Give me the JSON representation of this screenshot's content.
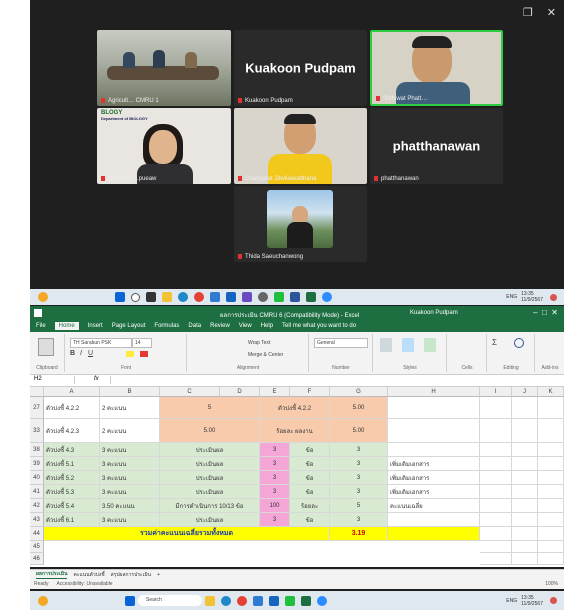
{
  "zoom": {
    "controls": [
      "❐",
      "✕"
    ],
    "participants": [
      {
        "name": "Agricult… CMRU 1",
        "kind": "video-room"
      },
      {
        "name": "Kuakoon Pudpam",
        "kind": "name-only"
      },
      {
        "name": "Sitthiwat Phatt…",
        "kind": "video-man"
      },
      {
        "name": "Natthinee ..pueaw",
        "kind": "video-woman-glasses"
      },
      {
        "name": "Chanyarat Jitwilaiwatthana",
        "kind": "video-man-yellow"
      },
      {
        "name": "phatthanawan",
        "kind": "name-only"
      },
      {
        "name": "Thida Saeuchanwong",
        "kind": "photo-woman"
      }
    ],
    "big_names": {
      "kuakoon": "Kuakoon Pudpam",
      "phatthanawan": "phatthanawan"
    },
    "logo_text": "BLOGY",
    "logo_sub": "Department of BIOLOGY"
  },
  "taskbar_top": {
    "time": "13:35",
    "date": "11/9/2567",
    "tray": "ENG"
  },
  "excel": {
    "title": "ผลการประเมิน CMRU 6 (Compatibility Mode) - Excel",
    "user": "Kuakoon Pudpam",
    "tabs": [
      "File",
      "Home",
      "Insert",
      "Page Layout",
      "Formulas",
      "Data",
      "Review",
      "View",
      "Help",
      "Tell me what you want to do"
    ],
    "active_tab": "Home",
    "ribbon_groups": [
      "Clipboard",
      "Font",
      "Alignment",
      "Number",
      "Styles",
      "Cells",
      "Editing",
      "Add-ins"
    ],
    "font_name": "TH Sarabun PSK",
    "font_size": "14",
    "number_format": "General",
    "wrap_text": "Wrap Text",
    "merge": "Merge & Center",
    "cell_ref": "H2",
    "fx": "fx",
    "columns": [
      "A",
      "B",
      "C",
      "D",
      "E",
      "F",
      "G",
      "H",
      "I",
      "J",
      "K"
    ],
    "rows": [
      {
        "n": "27",
        "A": "ตัวบ่งชี้ 4.2.2",
        "B": "2 คะแนน",
        "C": "5",
        "EF": "ตัวบ่งชี้ 4.2.2",
        "G": "5.00"
      },
      {
        "n": "33",
        "A": "ตัวบ่งชี้ 4.2.3",
        "B": "2 คะแนน",
        "C": "5.00",
        "C2": "5",
        "EF": "ร้อยละ ผลงาน",
        "G": "5.00"
      },
      {
        "n": "38",
        "A": "ตัวบ่งชี้ 4.3",
        "B": "3 คะแนน",
        "C": "ประเมินผล",
        "E": "3",
        "F": "ข้อ",
        "G": "3",
        "H": ""
      },
      {
        "n": "39",
        "A": "ตัวบ่งชี้ 5.1",
        "B": "3 คะแนน",
        "C": "ประเมินผล",
        "E": "3",
        "F": "ข้อ",
        "G": "3",
        "H": "เพิ่มเติมเอกสาร"
      },
      {
        "n": "40",
        "A": "ตัวบ่งชี้ 5.2",
        "B": "3 คะแนน",
        "C": "ประเมินผล",
        "E": "3",
        "F": "ข้อ",
        "G": "3",
        "H": "เพิ่มเติมเอกสาร"
      },
      {
        "n": "41",
        "A": "ตัวบ่งชี้ 5.3",
        "B": "3 คะแนน",
        "C": "ประเมินผล",
        "E": "3",
        "F": "ข้อ",
        "G": "3",
        "H": "เพิ่มเติมเอกสาร"
      },
      {
        "n": "42",
        "A": "ตัวบ่งชี้ 5.4",
        "B": "3.50 คะแนน",
        "C": "มีการดำเนินการ 10/13 ข้อ",
        "E": "100",
        "F": "ร้อยละ",
        "G": "5",
        "H": "คะแนนเฉลี่ย"
      },
      {
        "n": "43",
        "A": "ตัวบ่งชี้ 6.1",
        "B": "3 คะแนน",
        "C": "ประเมินผล",
        "E": "3",
        "F": "ข้อ",
        "G": "3",
        "H": ""
      },
      {
        "n": "44",
        "total_label": "รวมค่าคะแนนเฉลี่ยรวมทั้งหมด",
        "G": "3.19"
      },
      {
        "n": "45"
      },
      {
        "n": "46"
      }
    ],
    "sheet_tabs": [
      "ผลการประเมิน",
      "คะแนนตัวบ่งชี้",
      "สรุปผลการประเมิน",
      "+"
    ],
    "status": "Ready",
    "status2": "Accessibility: Unavailable",
    "zoom_level": "100%"
  },
  "taskbar_bottom": {
    "search": "Search",
    "time": "13:35",
    "date": "11/9/2567",
    "tray": "ENG"
  }
}
